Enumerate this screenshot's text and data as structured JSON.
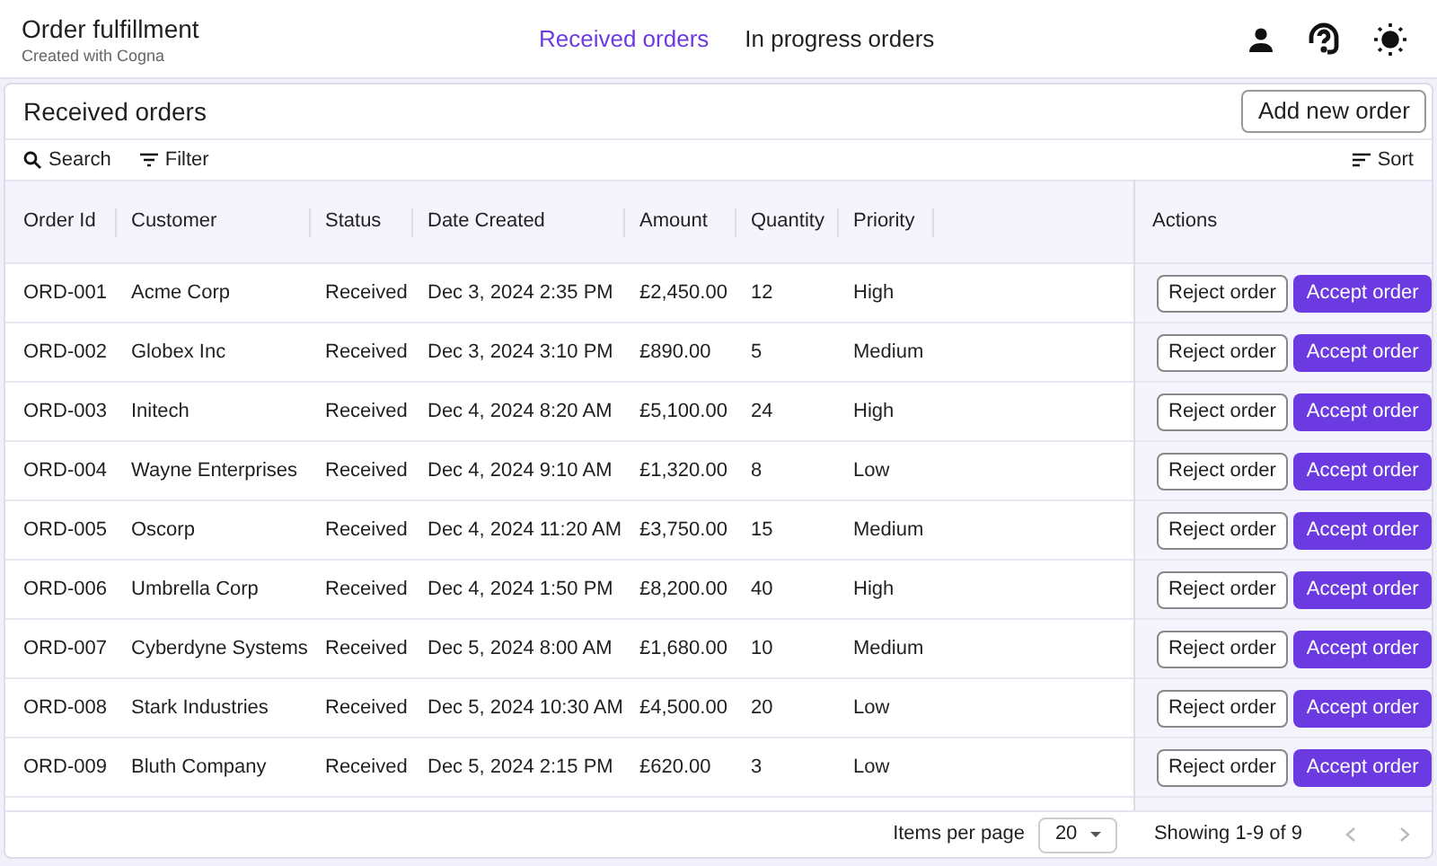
{
  "app": {
    "title": "Order fulfillment",
    "subtitle": "Created with Cogna"
  },
  "tabs": [
    {
      "label": "Received orders",
      "selected": true
    },
    {
      "label": "In progress orders",
      "selected": false
    }
  ],
  "panel": {
    "title": "Received orders",
    "add_button": "Add new order"
  },
  "toolbar": {
    "search": "Search",
    "filter": "Filter",
    "sort": "Sort"
  },
  "table": {
    "columns": [
      "Order Id",
      "Customer",
      "Status",
      "Date Created",
      "Amount",
      "Quantity",
      "Priority"
    ],
    "actions_column": "Actions",
    "rows": [
      {
        "cells": [
          "ORD-001",
          "Acme Corp",
          "Received",
          "Dec 3, 2024 2:35 PM",
          "£2,450.00",
          "12",
          "High"
        ],
        "reject": "Reject order",
        "accept": "Accept order"
      },
      {
        "cells": [
          "ORD-002",
          "Globex Inc",
          "Received",
          "Dec 3, 2024 3:10 PM",
          "£890.00",
          "5",
          "Medium"
        ],
        "reject": "Reject order",
        "accept": "Accept order"
      },
      {
        "cells": [
          "ORD-003",
          "Initech",
          "Received",
          "Dec 4, 2024 8:20 AM",
          "£5,100.00",
          "24",
          "High"
        ],
        "reject": "Reject order",
        "accept": "Accept order"
      },
      {
        "cells": [
          "ORD-004",
          "Wayne Enterprises",
          "Received",
          "Dec 4, 2024 9:10 AM",
          "£1,320.00",
          "8",
          "Low"
        ],
        "reject": "Reject order",
        "accept": "Accept order"
      },
      {
        "cells": [
          "ORD-005",
          "Oscorp",
          "Received",
          "Dec 4, 2024 11:20 AM",
          "£3,750.00",
          "15",
          "Medium"
        ],
        "reject": "Reject order",
        "accept": "Accept order"
      },
      {
        "cells": [
          "ORD-006",
          "Umbrella Corp",
          "Received",
          "Dec 4, 2024 1:50 PM",
          "£8,200.00",
          "40",
          "High"
        ],
        "reject": "Reject order",
        "accept": "Accept order"
      },
      {
        "cells": [
          "ORD-007",
          "Cyberdyne Systems",
          "Received",
          "Dec 5, 2024 8:00 AM",
          "£1,680.00",
          "10",
          "Medium"
        ],
        "reject": "Reject order",
        "accept": "Accept order"
      },
      {
        "cells": [
          "ORD-008",
          "Stark Industries",
          "Received",
          "Dec 5, 2024 10:30 AM",
          "£4,500.00",
          "20",
          "Low"
        ],
        "reject": "Reject order",
        "accept": "Accept order"
      },
      {
        "cells": [
          "ORD-009",
          "Bluth Company",
          "Received",
          "Dec 5, 2024 2:15 PM",
          "£620.00",
          "3",
          "Low"
        ],
        "reject": "Reject order",
        "accept": "Accept order"
      }
    ]
  },
  "footer": {
    "items_per_page_label": "Items per page",
    "items_per_page": "20",
    "showing": "Showing 1-9 of 9"
  }
}
